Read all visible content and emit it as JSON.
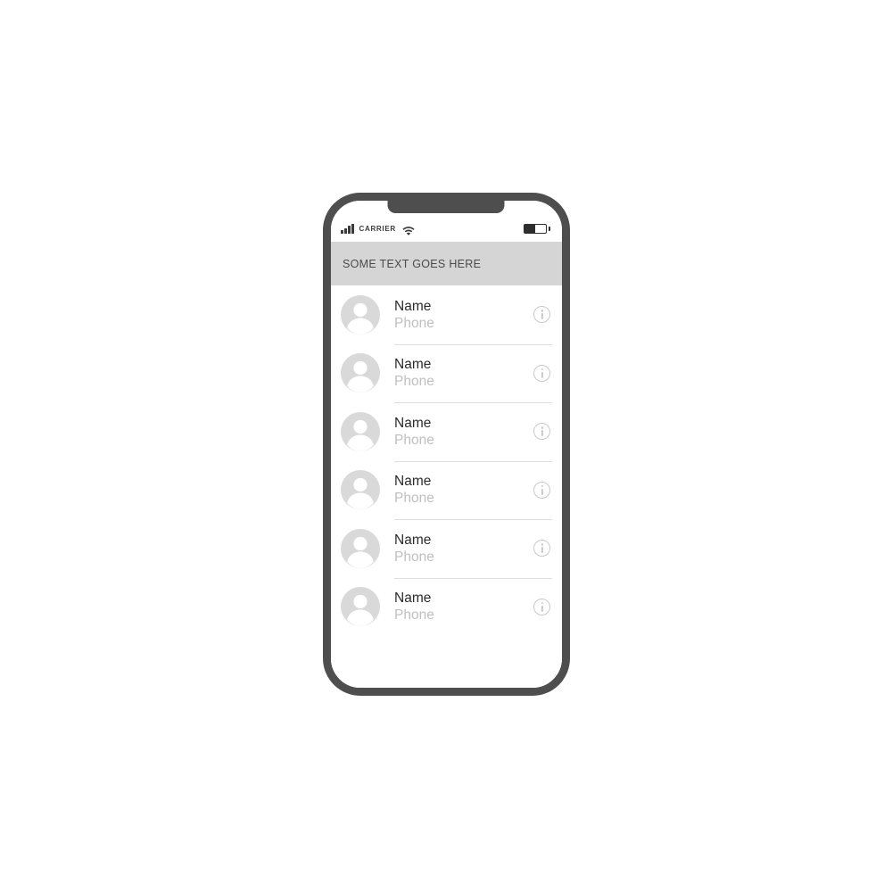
{
  "device": {
    "name": "smartphone-mockup",
    "frame_color": "#4e4e4e",
    "screen_background": "#ffffff"
  },
  "status_bar": {
    "signal_icon": "signal-bars-icon",
    "signal_bars_filled": 4,
    "signal_bars_total": 4,
    "carrier": "CARRIER",
    "wifi_icon": "wifi-icon",
    "battery_icon": "battery-icon",
    "battery_level_percent": 52
  },
  "header": {
    "title": "SOME TEXT GOES HERE",
    "background": "#d5d5d5",
    "text_color": "#4a4a4a"
  },
  "list": {
    "divider_color": "#dedede",
    "avatar_color": "#d9d9d9",
    "name_color": "#2b2b2b",
    "phone_color": "#bfbfbf",
    "info_icon_color": "#c9c9c9",
    "rows": [
      {
        "name": "Name",
        "phone": "Phone",
        "info_icon": "info-circle-icon",
        "avatar_icon": "person-placeholder-icon"
      },
      {
        "name": "Name",
        "phone": "Phone",
        "info_icon": "info-circle-icon",
        "avatar_icon": "person-placeholder-icon"
      },
      {
        "name": "Name",
        "phone": "Phone",
        "info_icon": "info-circle-icon",
        "avatar_icon": "person-placeholder-icon"
      },
      {
        "name": "Name",
        "phone": "Phone",
        "info_icon": "info-circle-icon",
        "avatar_icon": "person-placeholder-icon"
      },
      {
        "name": "Name",
        "phone": "Phone",
        "info_icon": "info-circle-icon",
        "avatar_icon": "person-placeholder-icon"
      },
      {
        "name": "Name",
        "phone": "Phone",
        "info_icon": "info-circle-icon",
        "avatar_icon": "person-placeholder-icon"
      }
    ]
  }
}
